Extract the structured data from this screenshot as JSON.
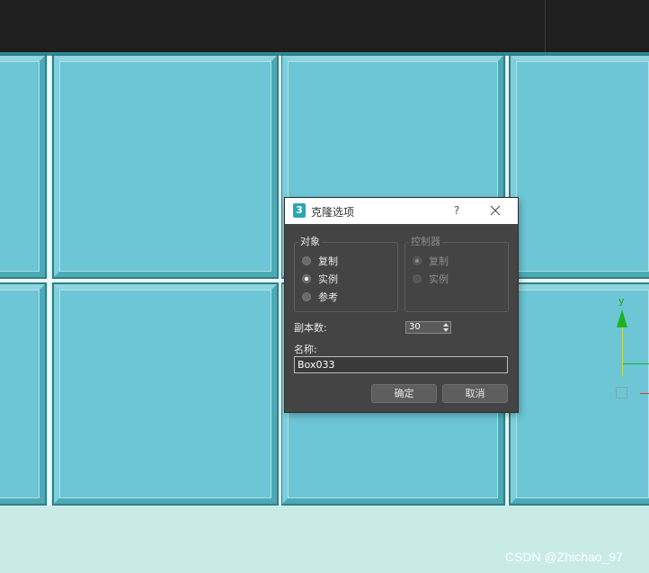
{
  "dialog": {
    "title": "克隆选项",
    "help": "?",
    "object_group": {
      "title": "对象",
      "options": [
        {
          "label": "复制",
          "checked": false
        },
        {
          "label": "实例",
          "checked": true
        },
        {
          "label": "参考",
          "checked": false
        }
      ]
    },
    "controller_group": {
      "title": "控制器",
      "options": [
        {
          "label": "复制",
          "checked": true,
          "disabled": true
        },
        {
          "label": "实例",
          "checked": false,
          "disabled": true
        }
      ]
    },
    "copies": {
      "label": "副本数:",
      "value": "30"
    },
    "name": {
      "label": "名称:",
      "value": "Box033"
    },
    "buttons": {
      "ok": "确定",
      "cancel": "取消"
    }
  },
  "viewport": {
    "gizmo_y_label": "y",
    "colors": {
      "tile": "#6cc6d5",
      "grout": "#2f8c94",
      "floor": "#c9ebe5",
      "dialog": "#444444"
    }
  },
  "watermark": "CSDN @Zhichao_97"
}
